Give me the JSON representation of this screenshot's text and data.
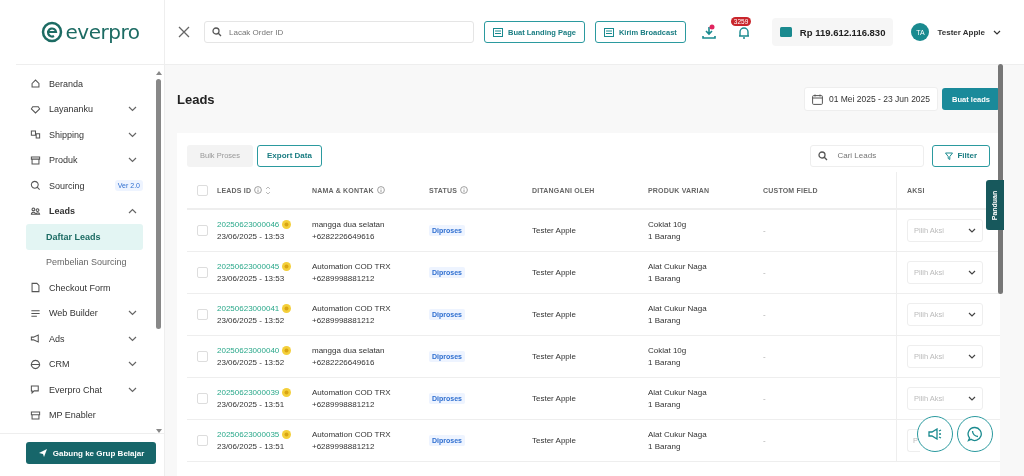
{
  "logo": {
    "text": "everpro"
  },
  "sidebar": {
    "items": [
      {
        "label": "Beranda",
        "expandable": false,
        "expanded": false,
        "selected": false
      },
      {
        "label": "Layananku",
        "expandable": true,
        "expanded": false,
        "selected": false
      },
      {
        "label": "Shipping",
        "expandable": true,
        "expanded": false,
        "selected": false
      },
      {
        "label": "Produk",
        "expandable": true,
        "expanded": false,
        "selected": false
      },
      {
        "label": "Sourcing",
        "badge": "Ver 2.0",
        "expandable": false,
        "expanded": false,
        "selected": false
      },
      {
        "label": "Leads",
        "expandable": true,
        "expanded": true,
        "selected": false,
        "children": [
          {
            "label": "Daftar Leads",
            "selected": true
          },
          {
            "label": "Pembelian Sourcing",
            "selected": false
          }
        ]
      },
      {
        "label": "Checkout Form",
        "expandable": false,
        "expanded": false,
        "selected": false
      },
      {
        "label": "Web Builder",
        "expandable": true,
        "expanded": false,
        "selected": false
      },
      {
        "label": "Ads",
        "expandable": true,
        "expanded": false,
        "selected": false
      },
      {
        "label": "CRM",
        "expandable": true,
        "expanded": false,
        "selected": false
      },
      {
        "label": "Everpro Chat",
        "expandable": true,
        "expanded": false,
        "selected": false
      },
      {
        "label": "MP Enabler",
        "expandable": false,
        "expanded": false,
        "selected": false
      }
    ],
    "footer_button": "Gabung ke Grup Belajar"
  },
  "topbar": {
    "search": {
      "placeholder": "Lacak Order ID"
    },
    "buttons": [
      "Buat Landing Page",
      "Kirim Broadcast"
    ],
    "notification_count": "3259",
    "balance": "Rp 119.612.116.830",
    "user": {
      "initials": "TA",
      "name": "Tester Apple"
    }
  },
  "page": {
    "title": "Leads",
    "date_range": "01 Mei 2025 - 23 Jun 2025",
    "primary_button": "Buat leads"
  },
  "toolbar": {
    "bulk_button": {
      "label": "Bulk Proses",
      "disabled": true
    },
    "export_button": "Export Data",
    "search": {
      "placeholder": "Cari Leads"
    },
    "filter_button": "Filter"
  },
  "table": {
    "all_checked": false,
    "columns": [
      {
        "label": "LEADS ID"
      },
      {
        "label": "NAMA & KONTAK"
      },
      {
        "label": "STATUS"
      },
      {
        "label": "DITANGANI OLEH"
      },
      {
        "label": "PRODUK VARIAN"
      },
      {
        "label": "CUSTOM FIELD"
      },
      {
        "label": "AKSI"
      }
    ],
    "rows": [
      {
        "checked": false,
        "id": "20250623000046",
        "date": "23/06/2025 - 13:53",
        "name": "mangga dua selatan",
        "phone": "+6282226649616",
        "status": "Diproses",
        "handler": "Tester Apple",
        "product": "Coklat 10g",
        "quantity": "1 Barang",
        "custom_field": "-",
        "action_placeholder": "Pilih Aksi"
      },
      {
        "checked": false,
        "id": "20250623000045",
        "date": "23/06/2025 - 13:53",
        "name": "Automation COD TRX",
        "phone": "+6289998881212",
        "status": "Diproses",
        "handler": "Tester Apple",
        "product": "Alat Cukur Naga",
        "quantity": "1 Barang",
        "custom_field": "-",
        "action_placeholder": "Pilih Aksi"
      },
      {
        "checked": false,
        "id": "20250623000041",
        "date": "23/06/2025 - 13:52",
        "name": "Automation COD TRX",
        "phone": "+6289998881212",
        "status": "Diproses",
        "handler": "Tester Apple",
        "product": "Alat Cukur Naga",
        "quantity": "1 Barang",
        "custom_field": "-",
        "action_placeholder": "Pilih Aksi"
      },
      {
        "checked": false,
        "id": "20250623000040",
        "date": "23/06/2025 - 13:52",
        "name": "mangga dua selatan",
        "phone": "+6282226649616",
        "status": "Diproses",
        "handler": "Tester Apple",
        "product": "Coklat 10g",
        "quantity": "1 Barang",
        "custom_field": "-",
        "action_placeholder": "Pilih Aksi"
      },
      {
        "checked": false,
        "id": "20250623000039",
        "date": "23/06/2025 - 13:51",
        "name": "Automation COD TRX",
        "phone": "+6289998881212",
        "status": "Diproses",
        "handler": "Tester Apple",
        "product": "Alat Cukur Naga",
        "quantity": "1 Barang",
        "custom_field": "-",
        "action_placeholder": "Pilih Aksi"
      },
      {
        "checked": false,
        "id": "20250623000035",
        "date": "23/06/2025 - 13:51",
        "name": "Automation COD TRX",
        "phone": "+6289998881212",
        "status": "Diproses",
        "handler": "Tester Apple",
        "product": "Alat Cukur Naga",
        "quantity": "1 Barang",
        "custom_field": "-",
        "action_placeholder": "P",
        "action_covered": true
      }
    ]
  },
  "help_tab": "Panduan"
}
